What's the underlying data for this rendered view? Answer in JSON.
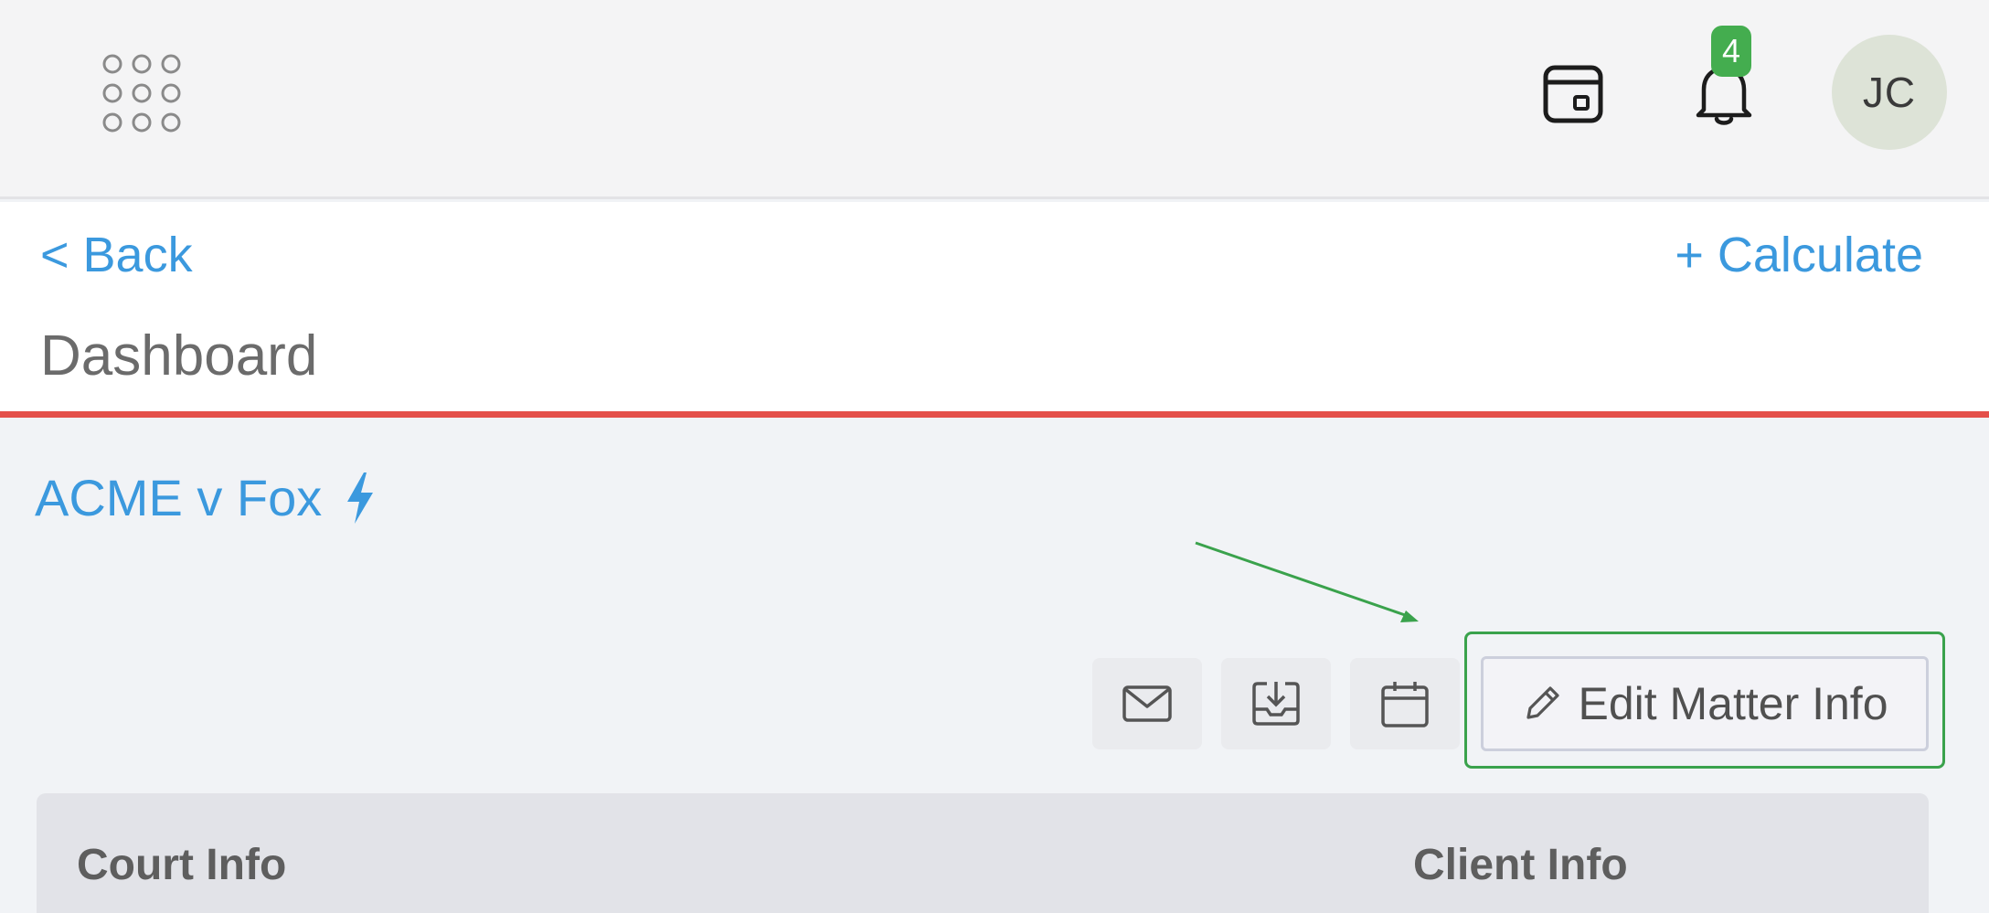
{
  "topbar": {
    "apps_icon": "grid-dots-icon",
    "calendar_icon": "calendar-box-icon",
    "notifications_icon": "bell-icon",
    "notification_count": "4",
    "avatar_initials": "JC"
  },
  "header": {
    "back_label": "< Back",
    "calculate_label": "+ Calculate",
    "page_title": "Dashboard",
    "accent_color": "#e4504a"
  },
  "matter": {
    "title": "ACME v Fox",
    "title_icon": "lightning-bolt-icon",
    "link_color": "#3b99de"
  },
  "actions": {
    "buttons": [
      {
        "icon": "mail-icon"
      },
      {
        "icon": "download-tray-icon"
      },
      {
        "icon": "calendar-icon"
      }
    ],
    "edit_label": "Edit Matter Info",
    "edit_icon": "pencil-icon",
    "highlight_color": "#3aa24c"
  },
  "panel": {
    "court_heading": "Court Info",
    "client_heading": "Client Info"
  }
}
